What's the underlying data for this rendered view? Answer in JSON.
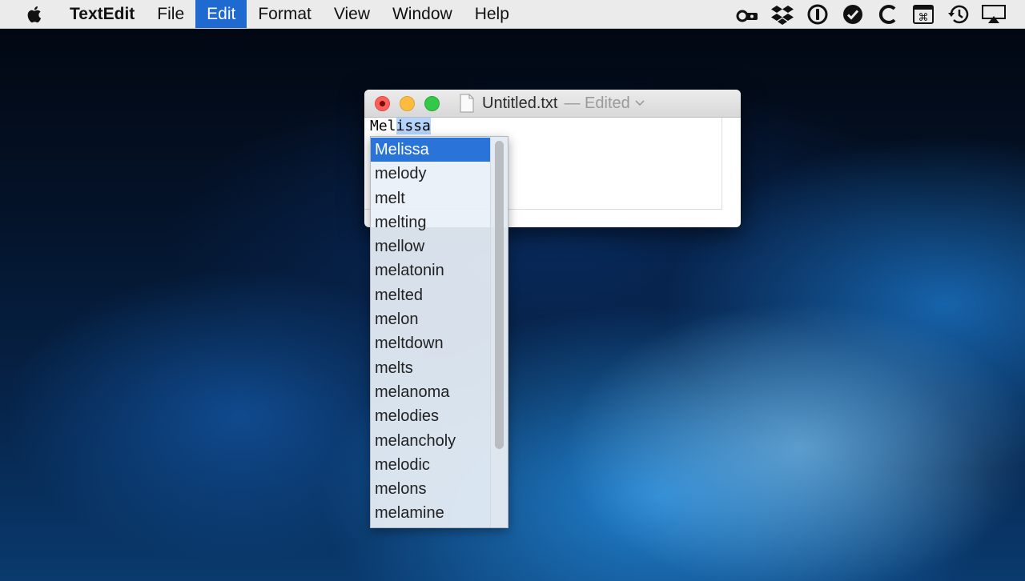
{
  "menubar": {
    "app_name": "TextEdit",
    "items": [
      "File",
      "Edit",
      "Format",
      "View",
      "Window",
      "Help"
    ],
    "active_item": "Edit",
    "status_icons": [
      "eyeglasses-key-icon",
      "dropbox-icon",
      "1password-icon",
      "checkmark-circle-icon",
      "c-app-icon",
      "command-key-icon",
      "time-machine-icon",
      "airplay-icon"
    ]
  },
  "window": {
    "title": "Untitled.txt",
    "status": "— Edited",
    "typed_prefix": "Mel",
    "typed_completion": "issa"
  },
  "completion": {
    "selected_index": 0,
    "items": [
      "Melissa",
      "melody",
      "melt",
      "melting",
      "mellow",
      "melatonin",
      "melted",
      "melon",
      "meltdown",
      "melts",
      "melanoma",
      "melodies",
      "melancholy",
      "melodic",
      "melons",
      "melamine"
    ]
  },
  "colors": {
    "menu_highlight": "#1f6ad0",
    "selection": "#2a74d9",
    "text_selection": "#b3d4fc"
  }
}
